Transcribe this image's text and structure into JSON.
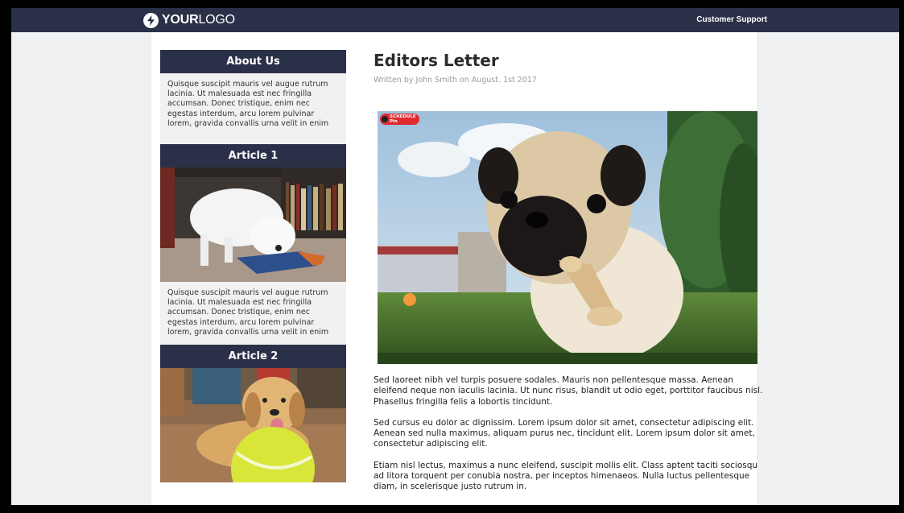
{
  "header": {
    "logo_bold": "YOUR",
    "logo_light": "LOGO",
    "support_link": "Customer Support"
  },
  "sidebar": {
    "about": {
      "title": "About Us",
      "text": "Quisque suscipit mauris vel augue rutrum lacinia. Ut malesuada est nec fringilla accumsan. Donec tristique, enim nec egestas interdum, arcu lorem pulvinar lorem, gravida convallis urna velit in enim"
    },
    "articles": [
      {
        "title": "Article 1",
        "image_alt": "white dog with toy",
        "text": "Quisque suscipit mauris vel augue rutrum lacinia. Ut malesuada est nec fringilla accumsan. Donec tristique, enim nec egestas interdum, arcu lorem pulvinar lorem, gravida convallis urna velit in enim"
      },
      {
        "title": "Article 2",
        "image_alt": "golden retriever with tennis ball"
      }
    ]
  },
  "main": {
    "title": "Editors Letter",
    "byline": "Written by John Smith on August. 1st 2017",
    "hero_badge": "SCHEDULE\nPin",
    "paragraphs": [
      "Sed laoreet nibh vel turpis posuere sodales. Mauris non pellentesque massa. Aenean eleifend neque non iaculis lacinia. Ut nunc risus, blandit ut odio eget, porttitor faucibus nisl. Phasellus fringilla felis a lobortis tincidunt.",
      "Sed cursus eu dolor ac dignissim. Lorem ipsum dolor sit amet, consectetur adipiscing elit. Aenean sed nulla maximus, aliquam purus nec, tincidunt elit. Lorem ipsum dolor sit amet, consectetur adipiscing elit.",
      "Etiam nisl lectus, maximus a nunc eleifend, suscipit mollis elit. Class aptent taciti sociosqu ad litora torquent per conubia nostra, per inceptos himenaeos. Nulla luctus pellentesque diam, in scelerisque justo rutrum in."
    ]
  },
  "colors": {
    "nav_bg": "#2b3049",
    "page_bg": "#eef0f1",
    "badge": "#e02b2f"
  }
}
